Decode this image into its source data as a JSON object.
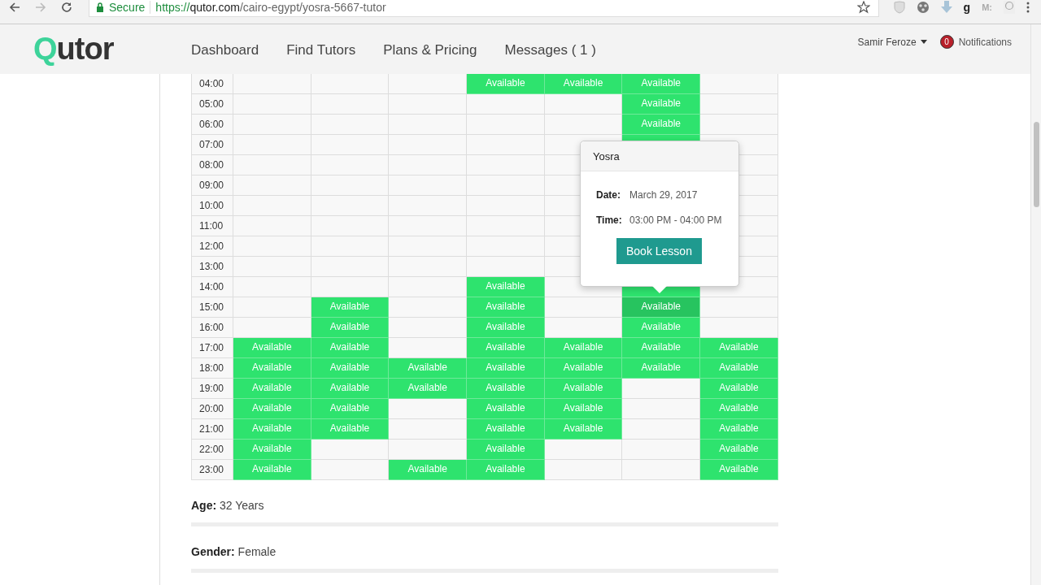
{
  "browser": {
    "secure_label": "Secure",
    "url_scheme": "https://",
    "url_host": "qutor.com",
    "url_path": "/cairo-egypt/yosra-5667-tutor",
    "extensions": [
      {
        "kind": "shield"
      },
      {
        "kind": "film"
      },
      {
        "kind": "download"
      },
      {
        "kind": "letter",
        "text": "g"
      },
      {
        "kind": "letter",
        "text": "M:"
      },
      {
        "kind": "badge"
      }
    ]
  },
  "header": {
    "logo": {
      "mark": "Q",
      "rest": "utor"
    },
    "nav": [
      {
        "label": "Dashboard"
      },
      {
        "label": "Find Tutors"
      },
      {
        "label": "Plans & Pricing"
      },
      {
        "label": "Messages ( 1 )"
      }
    ],
    "user": "Samir Feroze",
    "notifications": {
      "count": "0",
      "label": "Notifications"
    }
  },
  "schedule": {
    "rows": [
      {
        "time": "04:00",
        "cells": [
          {
            "available": false
          },
          {
            "available": false
          },
          {
            "available": false
          },
          {
            "available": true,
            "text": "Available",
            "selected": false
          },
          {
            "available": true,
            "text": "Available",
            "selected": false
          },
          {
            "available": true,
            "text": "Available",
            "selected": false
          },
          {
            "available": false
          }
        ]
      },
      {
        "time": "05:00",
        "cells": [
          {
            "available": false
          },
          {
            "available": false
          },
          {
            "available": false
          },
          {
            "available": false
          },
          {
            "available": false
          },
          {
            "available": true,
            "text": "Available",
            "selected": false
          },
          {
            "available": false
          }
        ]
      },
      {
        "time": "06:00",
        "cells": [
          {
            "available": false
          },
          {
            "available": false
          },
          {
            "available": false
          },
          {
            "available": false
          },
          {
            "available": false
          },
          {
            "available": true,
            "text": "Available",
            "selected": false
          },
          {
            "available": false
          }
        ]
      },
      {
        "time": "07:00",
        "cells": [
          {
            "available": false
          },
          {
            "available": false
          },
          {
            "available": false
          },
          {
            "available": false
          },
          {
            "available": false
          },
          {
            "available": true,
            "selected": false
          },
          {
            "available": false
          }
        ]
      },
      {
        "time": "08:00",
        "cells": [
          {
            "available": false
          },
          {
            "available": false
          },
          {
            "available": false
          },
          {
            "available": false
          },
          {
            "available": false
          },
          null,
          {
            "available": false
          }
        ]
      },
      {
        "time": "09:00",
        "cells": [
          {
            "available": false
          },
          {
            "available": false
          },
          {
            "available": false
          },
          {
            "available": false
          },
          {
            "available": false
          },
          null,
          {
            "available": false
          }
        ]
      },
      {
        "time": "10:00",
        "cells": [
          {
            "available": false
          },
          {
            "available": false
          },
          {
            "available": false
          },
          {
            "available": false
          },
          {
            "available": false
          },
          null,
          {
            "available": false
          }
        ]
      },
      {
        "time": "11:00",
        "cells": [
          {
            "available": false
          },
          {
            "available": false
          },
          {
            "available": false
          },
          {
            "available": false
          },
          {
            "available": false
          },
          null,
          {
            "available": false
          }
        ]
      },
      {
        "time": "12:00",
        "cells": [
          {
            "available": false
          },
          {
            "available": false
          },
          {
            "available": false
          },
          {
            "available": false
          },
          {
            "available": false
          },
          null,
          {
            "available": false
          }
        ]
      },
      {
        "time": "13:00",
        "cells": [
          {
            "available": false
          },
          {
            "available": false
          },
          {
            "available": false
          },
          {
            "available": false
          },
          {
            "available": false
          },
          null,
          {
            "available": false
          }
        ]
      },
      {
        "time": "14:00",
        "cells": [
          {
            "available": false
          },
          {
            "available": false
          },
          {
            "available": false
          },
          {
            "available": true,
            "text": "Available",
            "selected": false
          },
          {
            "available": false
          },
          {
            "available": true,
            "selected": false
          },
          {
            "available": false
          }
        ]
      },
      {
        "time": "15:00",
        "cells": [
          {
            "available": false
          },
          {
            "available": true,
            "text": "Available",
            "selected": false
          },
          {
            "available": false
          },
          {
            "available": true,
            "text": "Available",
            "selected": false
          },
          {
            "available": false
          },
          {
            "available": true,
            "text": "Available",
            "selected": true
          },
          {
            "available": false
          }
        ]
      },
      {
        "time": "16:00",
        "cells": [
          {
            "available": false
          },
          {
            "available": true,
            "text": "Available",
            "selected": false
          },
          {
            "available": false
          },
          {
            "available": true,
            "text": "Available",
            "selected": false
          },
          {
            "available": false
          },
          {
            "available": true,
            "text": "Available",
            "selected": false
          },
          {
            "available": false
          }
        ]
      },
      {
        "time": "17:00",
        "cells": [
          {
            "available": true,
            "text": "Available",
            "selected": false
          },
          {
            "available": true,
            "text": "Available",
            "selected": false
          },
          {
            "available": false
          },
          {
            "available": true,
            "text": "Available",
            "selected": false
          },
          {
            "available": true,
            "text": "Available",
            "selected": false
          },
          {
            "available": true,
            "text": "Available",
            "selected": false
          },
          {
            "available": true,
            "text": "Available",
            "selected": false
          }
        ]
      },
      {
        "time": "18:00",
        "cells": [
          {
            "available": true,
            "text": "Available",
            "selected": false
          },
          {
            "available": true,
            "text": "Available",
            "selected": false
          },
          {
            "available": true,
            "text": "Available",
            "selected": false
          },
          {
            "available": true,
            "text": "Available",
            "selected": false
          },
          {
            "available": true,
            "text": "Available",
            "selected": false
          },
          {
            "available": true,
            "text": "Available",
            "selected": false
          },
          {
            "available": true,
            "text": "Available",
            "selected": false
          }
        ]
      },
      {
        "time": "19:00",
        "cells": [
          {
            "available": true,
            "text": "Available",
            "selected": false
          },
          {
            "available": true,
            "text": "Available",
            "selected": false
          },
          {
            "available": true,
            "text": "Available",
            "selected": false
          },
          {
            "available": true,
            "text": "Available",
            "selected": false
          },
          {
            "available": true,
            "text": "Available",
            "selected": false
          },
          {
            "available": false
          },
          {
            "available": true,
            "text": "Available",
            "selected": false
          }
        ]
      },
      {
        "time": "20:00",
        "cells": [
          {
            "available": true,
            "text": "Available",
            "selected": false
          },
          {
            "available": true,
            "text": "Available",
            "selected": false
          },
          {
            "available": false
          },
          {
            "available": true,
            "text": "Available",
            "selected": false
          },
          {
            "available": true,
            "text": "Available",
            "selected": false
          },
          {
            "available": false
          },
          {
            "available": true,
            "text": "Available",
            "selected": false
          }
        ]
      },
      {
        "time": "21:00",
        "cells": [
          {
            "available": true,
            "text": "Available",
            "selected": false
          },
          {
            "available": true,
            "text": "Available",
            "selected": false
          },
          {
            "available": false
          },
          {
            "available": true,
            "text": "Available",
            "selected": false
          },
          {
            "available": true,
            "text": "Available",
            "selected": false
          },
          {
            "available": false
          },
          {
            "available": true,
            "text": "Available",
            "selected": false
          }
        ]
      },
      {
        "time": "22:00",
        "cells": [
          {
            "available": true,
            "text": "Available",
            "selected": false
          },
          {
            "available": false
          },
          {
            "available": false
          },
          {
            "available": true,
            "text": "Available",
            "selected": false
          },
          {
            "available": false
          },
          {
            "available": false
          },
          {
            "available": true,
            "text": "Available",
            "selected": false
          }
        ]
      },
      {
        "time": "23:00",
        "cells": [
          {
            "available": true,
            "text": "Available",
            "selected": false
          },
          {
            "available": false
          },
          {
            "available": true,
            "text": "Available",
            "selected": false
          },
          {
            "available": true,
            "text": "Available",
            "selected": false
          },
          {
            "available": false
          },
          {
            "available": false
          },
          {
            "available": true,
            "text": "Available",
            "selected": false
          }
        ]
      }
    ],
    "popover": {
      "title": "Yosra",
      "fields": [
        {
          "label": "Date:",
          "value": "March 29, 2017"
        },
        {
          "label": "Time:",
          "value": "03:00 PM - 04:00 PM"
        }
      ],
      "button": "Book Lesson"
    }
  },
  "profile": [
    {
      "label": "Age:",
      "value": "32 Years"
    },
    {
      "label": "Gender:",
      "value": "Female"
    }
  ]
}
